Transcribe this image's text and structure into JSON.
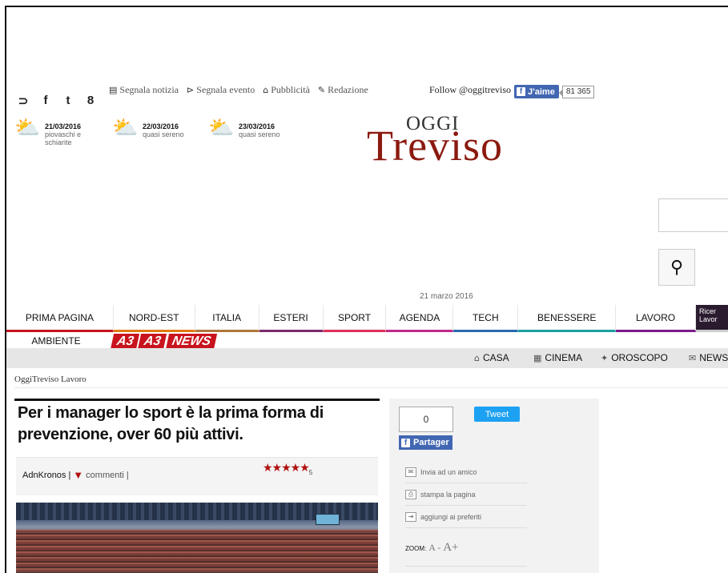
{
  "social": {
    "icons": [
      "rss-icon",
      "facebook-icon",
      "twitter-icon",
      "gplus-icon"
    ],
    "glyphs": [
      "⊃",
      "f",
      "t",
      "8"
    ]
  },
  "toplinks": [
    {
      "icon": "newspaper-icon",
      "glyph": "▤",
      "label": "Segnala notizia"
    },
    {
      "icon": "megaphone-icon",
      "glyph": "⊳",
      "label": "Segnala evento"
    },
    {
      "icon": "tag-icon",
      "glyph": "⌂",
      "label": "Pubblicità"
    },
    {
      "icon": "pencil-icon",
      "glyph": "✎",
      "label": "Redazione"
    }
  ],
  "follow": "Follow @oggitreviso",
  "fb_like": {
    "label": "J'aime",
    "count": "81 365"
  },
  "weather": [
    {
      "date": "21/03/2016",
      "desc": "piovaschi e schiarite"
    },
    {
      "date": "22/03/2016",
      "desc": "quasi sereno"
    },
    {
      "date": "23/03/2016",
      "desc": "quasi sereno"
    }
  ],
  "logo": {
    "top": "OGGI",
    "main": "Treviso"
  },
  "date": "21 marzo 2016",
  "nav": [
    {
      "label": "PRIMA PAGINA",
      "color": "#c8141e"
    },
    {
      "label": "NORD-EST",
      "color": "#e07a12"
    },
    {
      "label": "ITALIA",
      "color": "#b0763a"
    },
    {
      "label": "ESTERI",
      "color": "#7a2a6a"
    },
    {
      "label": "SPORT",
      "color": "#e0305a"
    },
    {
      "label": "AGENDA",
      "color": "#c02a8a"
    },
    {
      "label": "TECH",
      "color": "#2a6ab0"
    },
    {
      "label": "BENESSERE",
      "color": "#1aa0a0"
    },
    {
      "label": "LAVORO",
      "color": "#7a1a8a"
    }
  ],
  "nav_extra": {
    "top": "Ricer",
    "bottom": "Lavor"
  },
  "nav2": {
    "label": "AMBIENTE",
    "news_a": "A3",
    "news_b": "A3",
    "news_c": "NEWS"
  },
  "subnav": [
    {
      "icon": "home-icon",
      "glyph": "⌂",
      "label": "CASA"
    },
    {
      "icon": "film-icon",
      "glyph": "▦",
      "label": "CINEMA"
    },
    {
      "icon": "stars-icon",
      "glyph": "✦",
      "label": "OROSCOPO"
    },
    {
      "icon": "mail-icon",
      "glyph": "✉",
      "label": "NEWS"
    }
  ],
  "breadcrumb": "OggiTreviso Lavoro",
  "article": {
    "title": "Per i manager lo sport è la prima forma di prevenzione, over 60 più attivi.",
    "author": "AdnKronos",
    "comments": "commenti |",
    "rating": "5",
    "stars": "★★★★★"
  },
  "sidebar": {
    "count": "0",
    "tweet": "Tweet",
    "partager": "Partager",
    "links": [
      {
        "icon": "mail-icon",
        "glyph": "✉",
        "label": "Invia ad un amico"
      },
      {
        "icon": "print-icon",
        "glyph": "⎙",
        "label": "stampa la pagina"
      },
      {
        "icon": "bookmark-icon",
        "glyph": "⇥",
        "label": "aggiungi ai preferiti"
      }
    ],
    "zoom": {
      "label": "ZOOM:",
      "minus": "A -",
      "plus": "A+"
    }
  }
}
